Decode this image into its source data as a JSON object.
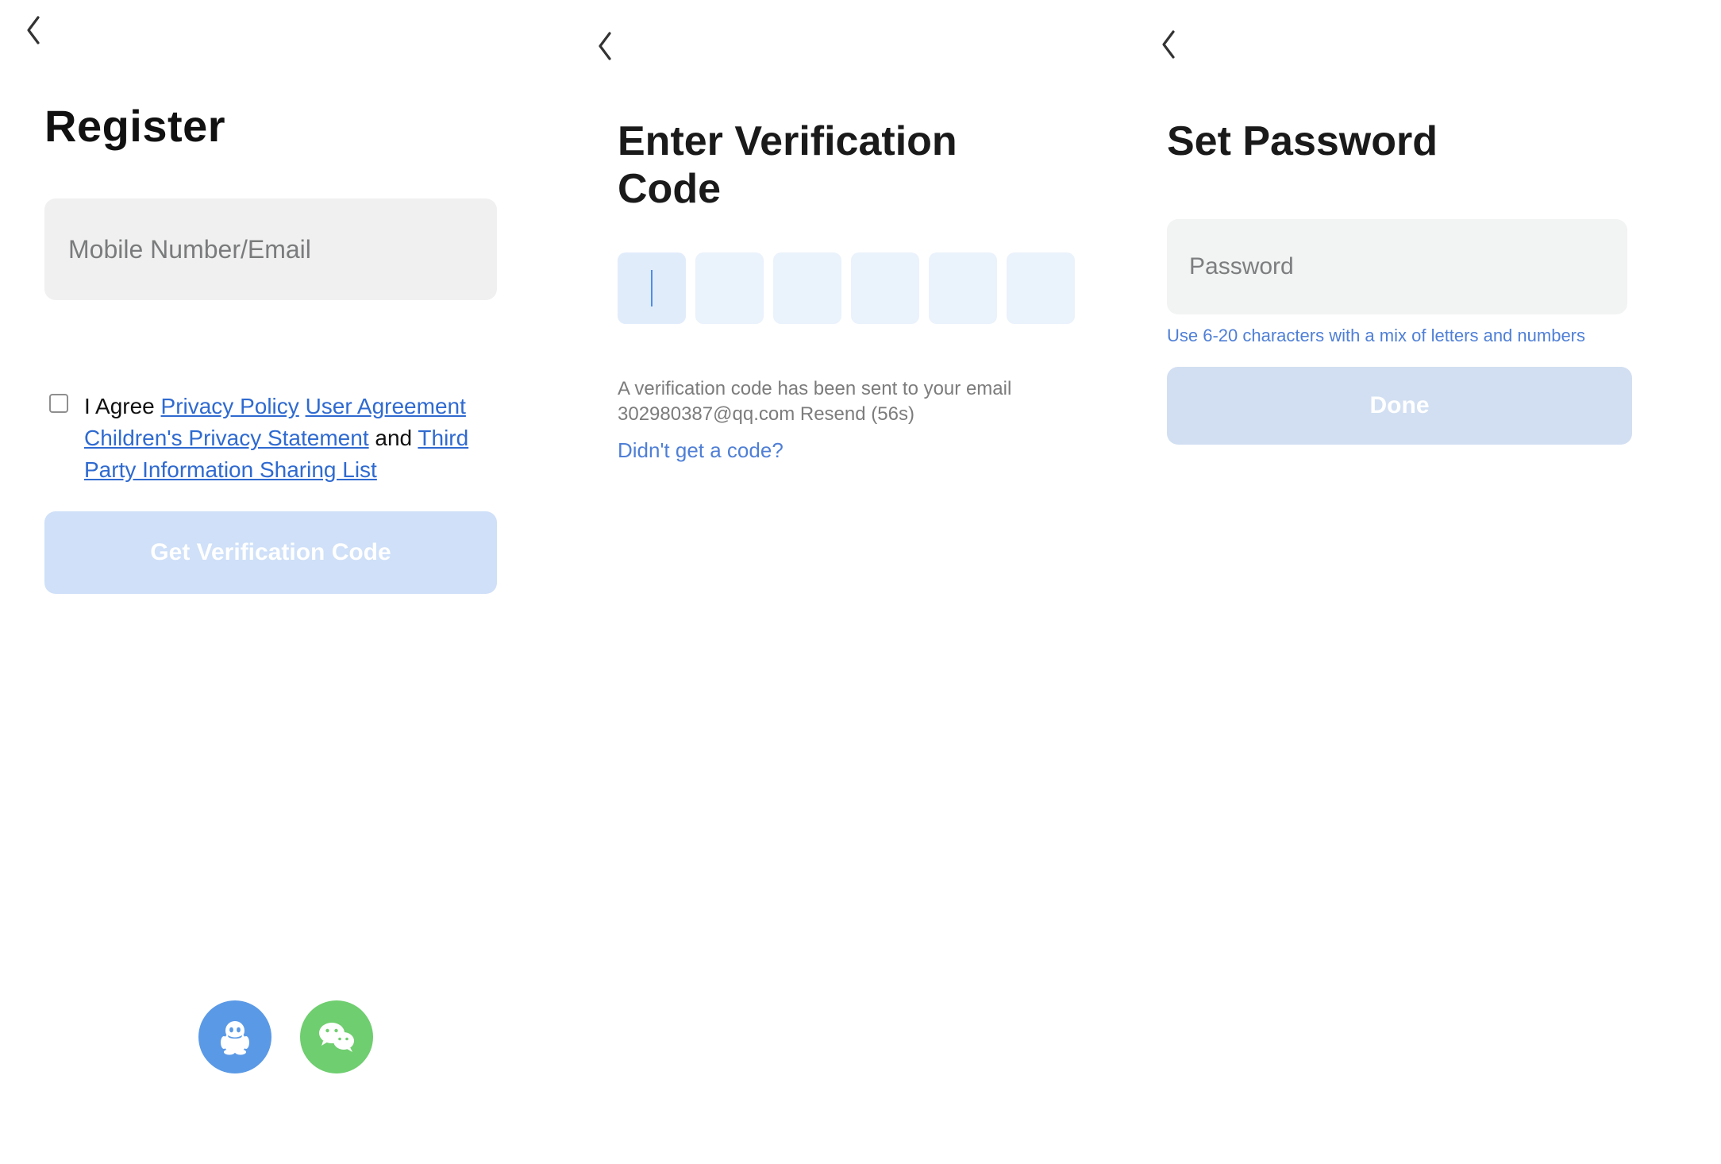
{
  "screen1": {
    "title": "Register",
    "input_placeholder": "Mobile Number/Email",
    "consent": {
      "prefix": "I Agree ",
      "privacy_policy": "Privacy Policy",
      "user_agreement": "User Agreement",
      "children_privacy": "Children's Privacy Statement",
      "joiner": " and ",
      "third_party": "Third Party Information Sharing List"
    },
    "cta": "Get Verification Code",
    "social": {
      "qq": "qq-icon",
      "wechat": "wechat-icon"
    }
  },
  "screen2": {
    "title": "Enter Verification Code",
    "sent_line1": "A verification code has been sent to your email",
    "sent_line2": "302980387@qq.com Resend (56s)",
    "no_code": "Didn't get a code?"
  },
  "screen3": {
    "title": "Set Password",
    "input_placeholder": "Password",
    "hint": "Use 6-20 characters with a mix of letters and numbers",
    "cta": "Done"
  }
}
